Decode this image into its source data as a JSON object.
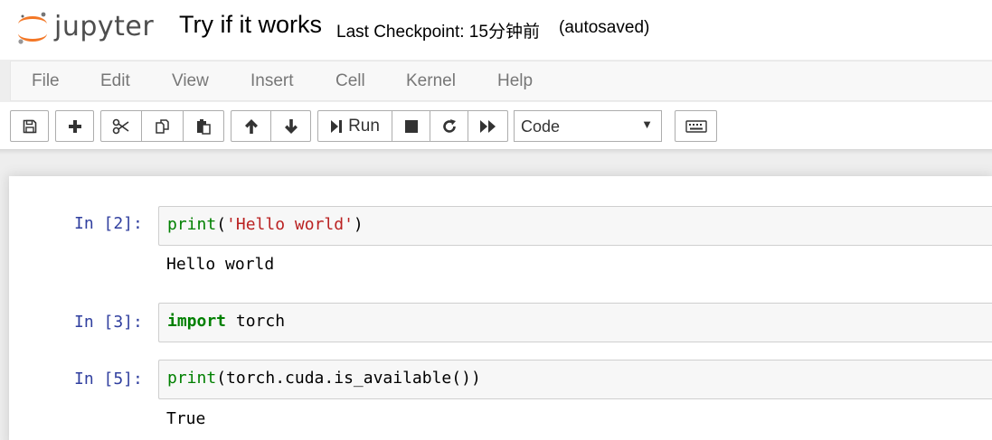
{
  "header": {
    "logo_text": "jupyter",
    "notebook_title": "Try if it works",
    "checkpoint": "Last Checkpoint: 15分钟前",
    "autosave_status": "(autosaved)"
  },
  "menubar": {
    "items": [
      "File",
      "Edit",
      "View",
      "Insert",
      "Cell",
      "Kernel",
      "Help"
    ]
  },
  "toolbar": {
    "run_label": "Run",
    "cell_type": "Code",
    "icons": [
      "save-icon",
      "plus-icon",
      "scissors-icon",
      "copy-icon",
      "paste-icon",
      "arrow-up-icon",
      "arrow-down-icon",
      "run-icon",
      "stop-icon",
      "restart-icon",
      "fast-forward-icon",
      "keyboard-icon"
    ]
  },
  "cells": [
    {
      "prompt": "In  [2]:",
      "code": {
        "t1": "print",
        "t2": "(",
        "t3": "'Hello world'",
        "t4": ")"
      },
      "output": "Hello world"
    },
    {
      "prompt": "In  [3]:",
      "code": {
        "t1": "import",
        "t2": " torch"
      },
      "output": ""
    },
    {
      "prompt": "In  [5]:",
      "code": {
        "t1": "print",
        "t2": "(torch.cuda.is_available())"
      },
      "output": "True"
    }
  ],
  "colors": {
    "prompt": "#303f9f",
    "builtin": "#008000",
    "string": "#ba2121",
    "logo_orange": "#f37726"
  }
}
